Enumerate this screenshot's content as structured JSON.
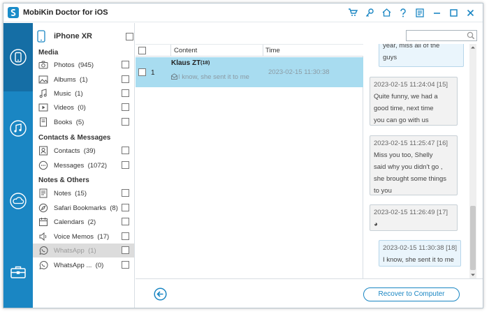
{
  "app": {
    "title": "MobiKin Doctor for iOS",
    "accent_color": "#1a86c3",
    "title_icons": [
      "cart-icon",
      "key-icon",
      "home-icon",
      "help-icon",
      "feedback-icon",
      "minimize-icon",
      "maximize-icon",
      "close-icon"
    ]
  },
  "rail": {
    "items": [
      {
        "name": "phone-recover-icon",
        "active": true
      },
      {
        "name": "itunes-recover-icon",
        "active": false
      },
      {
        "name": "icloud-recover-icon",
        "active": false
      },
      {
        "name": "toolbox-icon",
        "active": false
      }
    ]
  },
  "sidebar": {
    "device_name": "iPhone XR",
    "sections": [
      {
        "title": "Media",
        "items": [
          {
            "label": "Photos",
            "count": "(945)",
            "icon": "camera-icon"
          },
          {
            "label": "Albums",
            "count": "(1)",
            "icon": "album-icon"
          },
          {
            "label": "Music",
            "count": "(1)",
            "icon": "music-icon"
          },
          {
            "label": "Videos",
            "count": "(0)",
            "icon": "video-icon"
          },
          {
            "label": "Books",
            "count": "(5)",
            "icon": "book-icon"
          }
        ]
      },
      {
        "title": "Contacts & Messages",
        "items": [
          {
            "label": "Contacts",
            "count": "(39)",
            "icon": "contacts-icon"
          },
          {
            "label": "Messages",
            "count": "(1072)",
            "icon": "message-icon"
          }
        ]
      },
      {
        "title": "Notes & Others",
        "items": [
          {
            "label": "Notes",
            "count": "(15)",
            "icon": "notes-icon"
          },
          {
            "label": "Safari Bookmarks",
            "count": "(8)",
            "icon": "safari-icon"
          },
          {
            "label": "Calendars",
            "count": "(2)",
            "icon": "calendar-icon"
          },
          {
            "label": "Voice Memos",
            "count": "(17)",
            "icon": "voice-memo-icon"
          },
          {
            "label": "WhatsApp",
            "count": "(1)",
            "icon": "whatsapp-icon",
            "active": true
          },
          {
            "label": "WhatsApp ...",
            "count": "(0)",
            "icon": "whatsapp-icon"
          }
        ]
      }
    ]
  },
  "search": {
    "placeholder": ""
  },
  "table": {
    "columns": [
      "Content",
      "Time"
    ],
    "rows": [
      {
        "index": "1",
        "name": "Klaus ZT",
        "count": "(18)",
        "preview": "I know, she sent it to me",
        "time": "2023-02-15 11:30:38"
      }
    ]
  },
  "chat": {
    "messages": [
      {
        "side": "right",
        "meta": "",
        "lines": [
          "year, miss all of the",
          "guys"
        ]
      },
      {
        "side": "left",
        "meta": "2023-02-15 11:24:04  [15]",
        "lines": [
          "Quite funny, we had a",
          "good time, next time",
          "you can go with us"
        ]
      },
      {
        "side": "left",
        "meta": "2023-02-15 11:25:47  [16]",
        "lines": [
          "Miss you too, Shelly",
          "said why you didn't go ,",
          "she brought some things",
          "to you"
        ]
      },
      {
        "side": "left",
        "meta": "2023-02-15 11:26:49  [17]",
        "lines": [
          "◕"
        ]
      },
      {
        "side": "right",
        "meta": "2023-02-15 11:30:38  [18]",
        "lines": [
          "I know, she sent it to me"
        ]
      }
    ]
  },
  "footer": {
    "recover_label": "Recover to Computer"
  }
}
